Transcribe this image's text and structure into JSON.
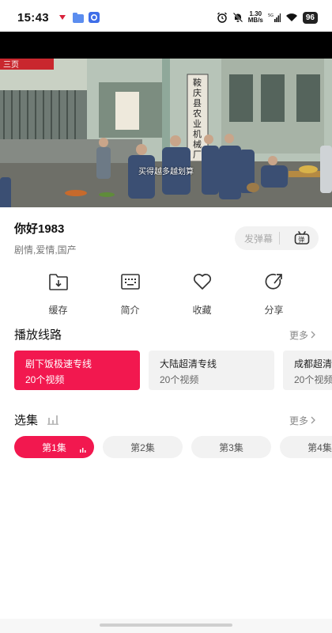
{
  "status_bar": {
    "time": "15:43",
    "net_speed_value": "1.30",
    "net_speed_unit": "MB/s",
    "battery": "96"
  },
  "video": {
    "subtitle": "买得越多越划算",
    "sign_text": "鞍庆县农业机械厂",
    "banner_text": "三页"
  },
  "show": {
    "title": "你好1983",
    "tags": "剧情,爱情,国产"
  },
  "danmaku": {
    "label": "发弹幕"
  },
  "actions": [
    {
      "label": "缓存",
      "icon": "download-icon"
    },
    {
      "label": "简介",
      "icon": "keyboard-icon"
    },
    {
      "label": "收藏",
      "icon": "heart-icon"
    },
    {
      "label": "分享",
      "icon": "share-icon"
    }
  ],
  "lines_section": {
    "title": "播放线路",
    "more": "更多",
    "items": [
      {
        "name": "剧下饭极速专线",
        "count": "20个视频",
        "active": true
      },
      {
        "name": "大陆超清专线",
        "count": "20个视频",
        "active": false
      },
      {
        "name": "成都超清",
        "count": "20个视频",
        "active": false
      }
    ]
  },
  "episodes_section": {
    "title": "选集",
    "more": "更多",
    "items": [
      {
        "label": "第1集",
        "active": true
      },
      {
        "label": "第2集",
        "active": false
      },
      {
        "label": "第3集",
        "active": false
      },
      {
        "label": "第4集",
        "active": false
      }
    ]
  },
  "colors": {
    "accent": "#f2184f",
    "muted_bg": "#f2f2f2"
  }
}
